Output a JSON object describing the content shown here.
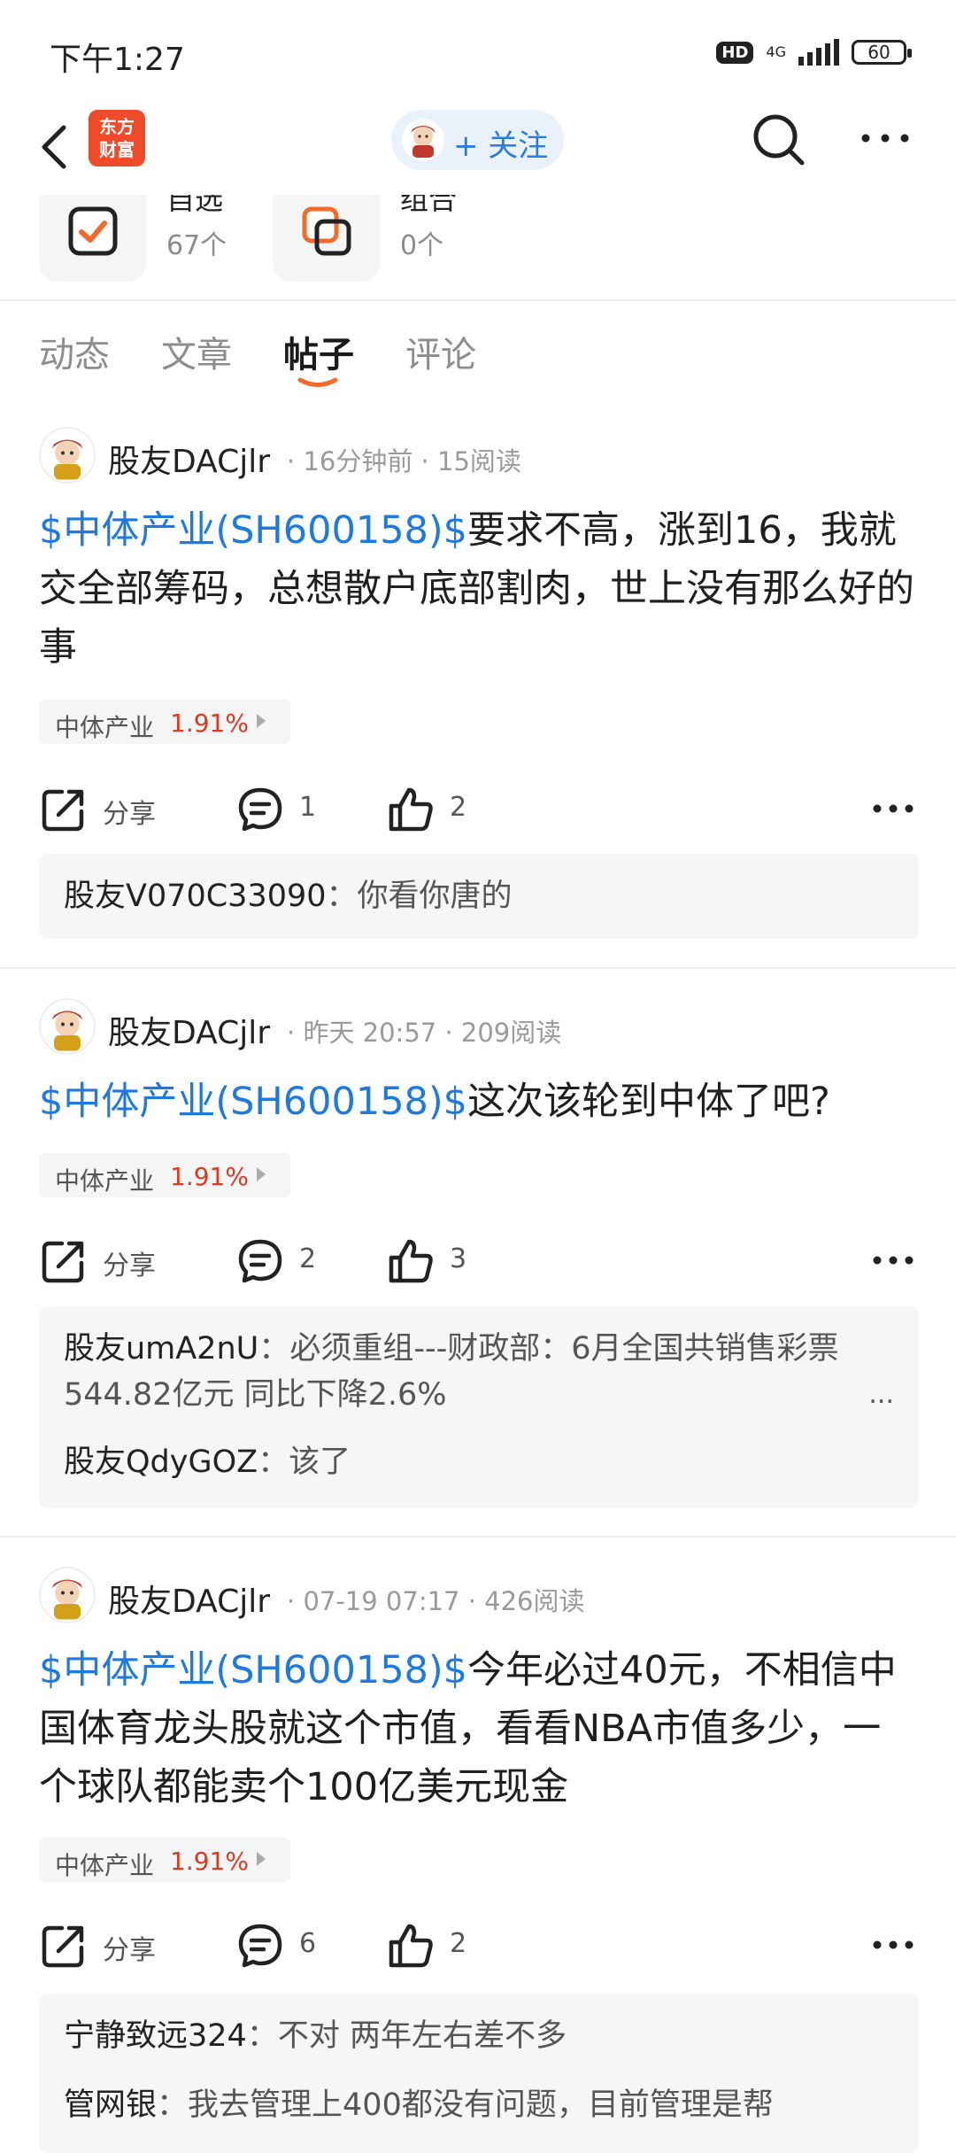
{
  "status_bar": {
    "time": "下午1:27",
    "hd": "HD",
    "network": "4G",
    "battery": "60"
  },
  "nav": {
    "logo_line1": "东方",
    "logo_line2": "财富",
    "follow_label": "+ 关注"
  },
  "cards": [
    {
      "title": "自选",
      "count": "67个"
    },
    {
      "title": "组合",
      "count": "0个"
    }
  ],
  "tabs": [
    "动态",
    "文章",
    "帖子",
    "评论"
  ],
  "active_tab": "帖子",
  "posts": [
    {
      "author": "股友DACjlr",
      "time": "16分钟前",
      "reads": "15阅读",
      "stock_link": "$中体产业(SH600158)$",
      "text": "要求不高，涨到16，我就交全部筹码，总想散户底部割肉，世上没有那么好的事",
      "tag_name": "中体产业",
      "tag_pct": "1.91%",
      "share_label": "分享",
      "comments_count": "1",
      "likes_count": "2",
      "comments": [
        {
          "user": "股友V070C33090",
          "text": "你看你唐的"
        }
      ]
    },
    {
      "author": "股友DACjlr",
      "time": "昨天 20:57",
      "reads": "209阅读",
      "stock_link": "$中体产业(SH600158)$",
      "text": "这次该轮到中体了吧?",
      "tag_name": "中体产业",
      "tag_pct": "1.91%",
      "share_label": "分享",
      "comments_count": "2",
      "likes_count": "3",
      "comments": [
        {
          "user": "股友umA2nU",
          "text": "必须重组---财政部：6月全国共销售彩票544.82亿元 同比下降2.6%"
        },
        {
          "user": "股友QdyGOZ",
          "text": "该了"
        }
      ],
      "more": "..."
    },
    {
      "author": "股友DACjlr",
      "time": "07-19 07:17",
      "reads": "426阅读",
      "stock_link": "$中体产业(SH600158)$",
      "text": "今年必过40元，不相信中国体育龙头股就这个市值，看看NBA市值多少，一个球队都能卖个100亿美元现金",
      "tag_name": "中体产业",
      "tag_pct": "1.91%",
      "share_label": "分享",
      "comments_count": "6",
      "likes_count": "2",
      "comments": [
        {
          "user": "宁静致远324",
          "text": "不对 两年左右差不多"
        },
        {
          "user": "管网银",
          "text": "我去管理上400都没有问题，目前管理是帮"
        }
      ]
    }
  ],
  "colors": {
    "link_blue": "#1f7ae0",
    "up_red": "#e0391e",
    "brand_orange": "#ef4a2a",
    "tab_accent": "#f26b2b"
  }
}
